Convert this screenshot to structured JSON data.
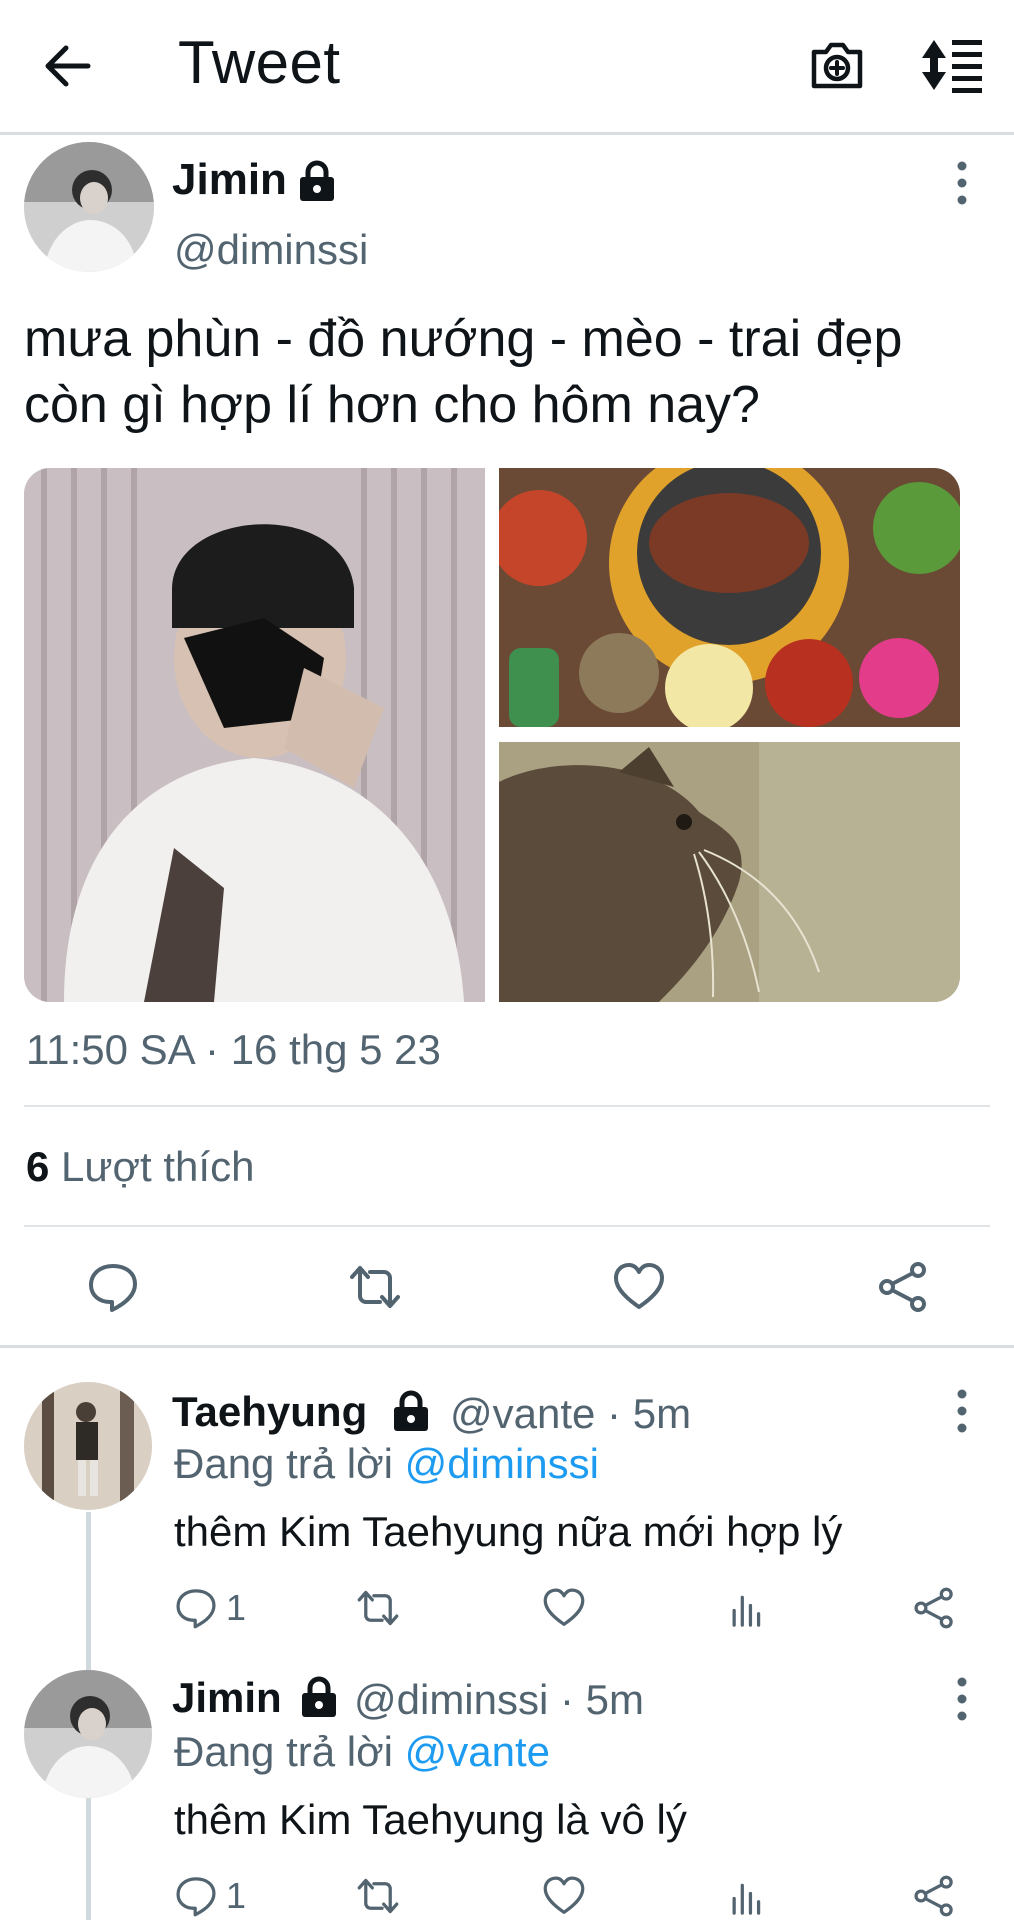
{
  "header": {
    "title": "Tweet",
    "back_icon": "arrow-left-icon",
    "camera_icon": "camera-plus-icon",
    "sort_icon": "sort-list-icon"
  },
  "tweet": {
    "author_name": "Jimin",
    "author_handle": "@diminssi",
    "protected_icon": "lock-icon",
    "text": "mưa phùn - đồ nướng - mèo - trai đẹp còn gì hợp lí hơn cho hôm nay?",
    "timestamp": "11:50 SA · 16 thg 5 23",
    "likes_count": "6",
    "likes_label": "Lượt thích",
    "media": [
      "person-photo",
      "bbq-food-photo",
      "cat-window-photo"
    ]
  },
  "replies": [
    {
      "author_name": "Taehyung",
      "author_handle": "@vante · 5m",
      "replying_prefix": "Đang trả lời",
      "replying_to": "@diminssi",
      "text": "thêm Kim Taehyung nữa mới hợp lý",
      "reply_count": "1"
    },
    {
      "author_name": "Jimin",
      "author_handle": "@diminssi · 5m",
      "replying_prefix": "Đang trả lời",
      "replying_to": "@vante",
      "text": "thêm Kim Taehyung là vô lý",
      "reply_count": "1"
    }
  ],
  "colors": {
    "text": "#0f1419",
    "secondary": "#536471",
    "link": "#1d9bf0",
    "divider": "#e1e5e8"
  }
}
